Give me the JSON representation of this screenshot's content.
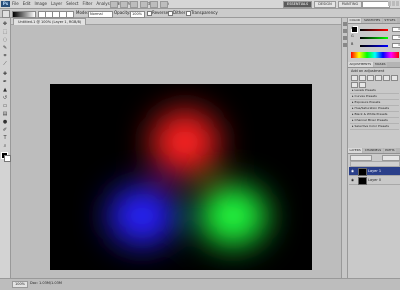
{
  "menubar": {
    "app_logo": "Ps",
    "menus": [
      "File",
      "Edit",
      "Image",
      "Layer",
      "Select",
      "Filter",
      "Analysis",
      "3D",
      "View",
      "Window",
      "Help"
    ],
    "workspaces": [
      {
        "label": "ESSENTIALS",
        "active": true
      },
      {
        "label": "DESIGN",
        "active": false
      },
      {
        "label": "PAINTING",
        "active": false
      }
    ]
  },
  "options": {
    "mode_label": "Mode:",
    "mode_value": "Normal",
    "opacity_label": "Opacity:",
    "opacity_value": "100%",
    "reverse_label": "Reverse",
    "dither_label": "Dither",
    "transparency_label": "Transparency"
  },
  "document": {
    "tab_label": "Untitled-1 @ 100% (Layer 1, RGB/8)"
  },
  "panels": {
    "color_tabs": [
      {
        "label": "COLOR",
        "active": true
      },
      {
        "label": "SWATCHES",
        "active": false
      },
      {
        "label": "STYLES",
        "active": false
      }
    ],
    "sliders": [
      {
        "label": "R",
        "value": "0",
        "gradient": "#ff0000"
      },
      {
        "label": "G",
        "value": "0",
        "gradient": "#00ff00"
      },
      {
        "label": "B",
        "value": "0",
        "gradient": "#0000ff"
      }
    ],
    "adjust_tabs": [
      {
        "label": "ADJUSTMENTS",
        "active": true
      },
      {
        "label": "MASKS",
        "active": false
      }
    ],
    "adjust_title": "Add an adjustment",
    "presets": [
      "Levels Presets",
      "Curves Presets",
      "Exposure Presets",
      "Hue/Saturation Presets",
      "Black & White Presets",
      "Channel Mixer Presets",
      "Selective Color Presets"
    ],
    "layers_tabs": [
      {
        "label": "LAYERS",
        "active": true
      },
      {
        "label": "CHANNELS",
        "active": false
      },
      {
        "label": "PATHS",
        "active": false
      }
    ],
    "layers": [
      {
        "name": "Layer 1",
        "selected": true
      },
      {
        "name": "Layer 0",
        "selected": false
      }
    ]
  },
  "status": {
    "zoom": "100%",
    "info": "Doc: 1.03M/1.03M"
  },
  "canvas": {
    "background": "#000000",
    "blobs": [
      {
        "name": "red-blob",
        "color": "#ff2020"
      },
      {
        "name": "blue-blob",
        "color": "#2a20ff"
      },
      {
        "name": "green-blob",
        "color": "#20ff40"
      }
    ]
  }
}
